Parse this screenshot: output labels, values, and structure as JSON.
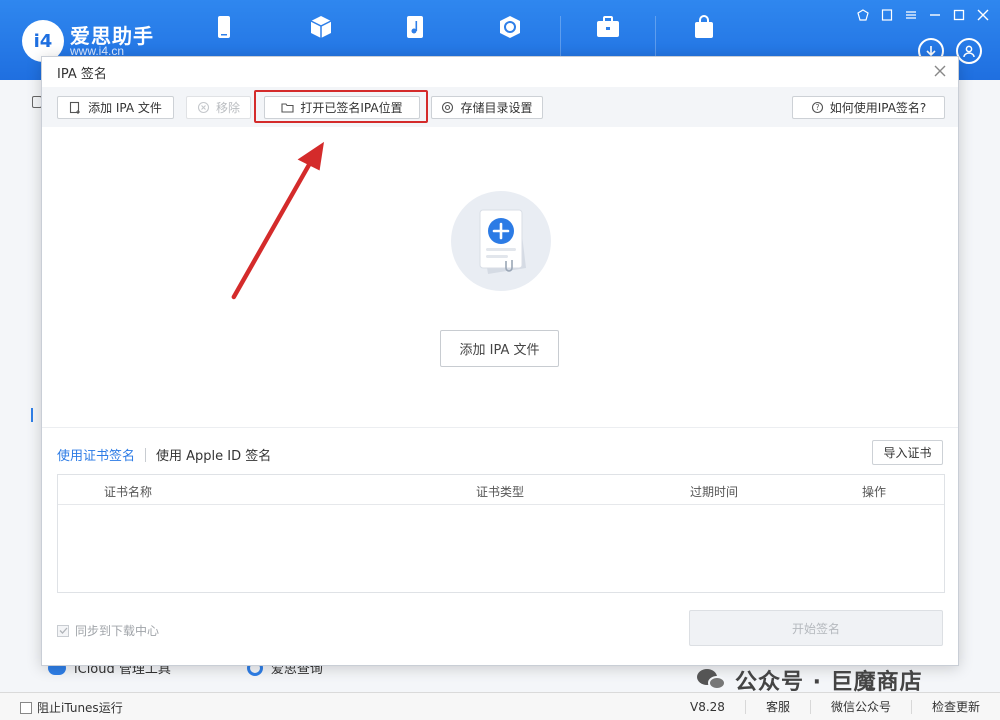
{
  "app": {
    "name": "爱思助手",
    "url": "www.i4.cn",
    "logo_mark": "i4"
  },
  "dialog": {
    "title": "IPA 签名",
    "toolbar": {
      "add_ipa": "添加 IPA 文件",
      "remove": "移除",
      "open_signed_location": "打开已签名IPA位置",
      "storage_settings": "存储目录设置",
      "how_to_use": "如何使用IPA签名?"
    },
    "add_ipa_main": "添加 IPA 文件",
    "tabs": {
      "cert_sign": "使用证书签名",
      "apple_id_sign": "使用 Apple ID 签名"
    },
    "import_cert": "导入证书",
    "table": {
      "columns": [
        "证书名称",
        "证书类型",
        "过期时间",
        "操作"
      ]
    },
    "sync_download": "同步到下载中心",
    "start_sign": "开始签名"
  },
  "background": {
    "icloud_tool": "iCloud 管理工具",
    "query": "爱思查询"
  },
  "status_bar": {
    "block_itunes": "阻止iTunes运行",
    "version": "V8.28",
    "support": "客服",
    "wechat": "微信公众号",
    "check_update": "检查更新"
  },
  "watermark": "公众号 · 巨魔商店",
  "colors": {
    "brand_blue": "#1f6fe0",
    "link_blue": "#2c7be5",
    "highlight_red": "#d42b2b"
  }
}
